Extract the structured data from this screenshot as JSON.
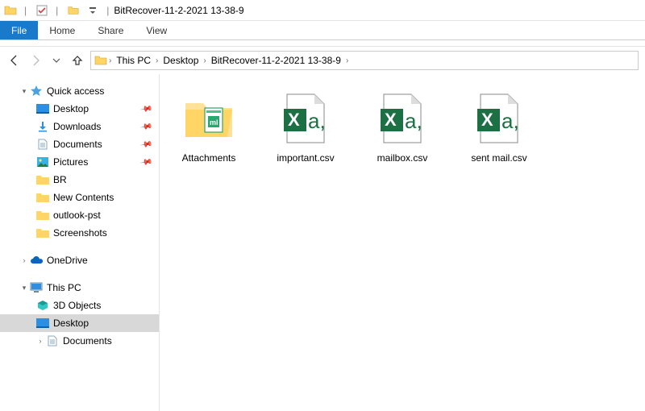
{
  "window": {
    "title": "BitRecover-11-2-2021 13-38-9"
  },
  "ribbon": {
    "file": "File",
    "home": "Home",
    "share": "Share",
    "view": "View"
  },
  "breadcrumbs": [
    "This PC",
    "Desktop",
    "BitRecover-11-2-2021 13-38-9"
  ],
  "sidebar": {
    "quick_access": "Quick access",
    "desktop": "Desktop",
    "downloads": "Downloads",
    "documents": "Documents",
    "pictures": "Pictures",
    "br": "BR",
    "new_contents": "New Contents",
    "outlook_pst": "outlook-pst",
    "screenshots": "Screenshots",
    "onedrive": "OneDrive",
    "this_pc": "This PC",
    "objects3d": "3D Objects",
    "desktop2": "Desktop",
    "documents2": "Documents"
  },
  "files": {
    "attachments": "Attachments",
    "important": "important.csv",
    "mailbox": "mailbox.csv",
    "sentmail": "sent mail.csv"
  }
}
